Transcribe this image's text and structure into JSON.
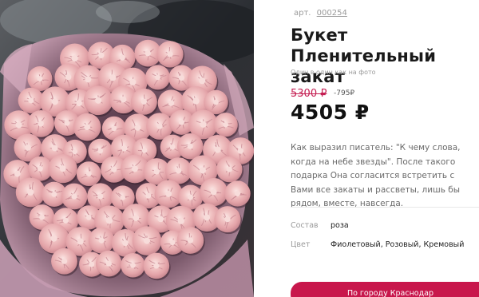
{
  "product": {
    "sku_label": "арт.",
    "sku_value": "000254",
    "title": "Букет Пленительный закат",
    "subtitle": "Один в один как на фото",
    "old_price": "5300 ₽",
    "discount": "-795₽",
    "price": "4505 ₽",
    "description": "Как выразил писатель: \"К чему слова, когда на небе звезды\". После такого подарка Она согласится встретить с Вами все закаты и рассветы, лишь бы рядом, вместе, навсегда.",
    "properties": [
      {
        "label": "Состав",
        "value": "роза"
      },
      {
        "label": "Цвет",
        "value": "Фиолетовый, Розовый, Кремовый"
      }
    ],
    "city_button_label": "По городу Краснодар"
  },
  "colors": {
    "accent": "#c8174c",
    "old_price": "#c41e52",
    "rose_petal": "#eeb9be",
    "wrapping": "#b88aa0"
  }
}
